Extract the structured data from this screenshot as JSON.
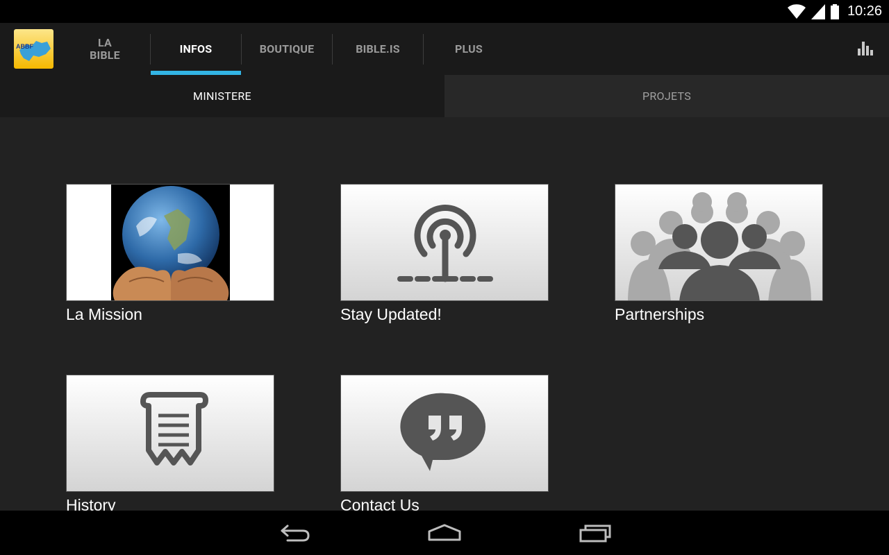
{
  "status_bar": {
    "time": "10:26",
    "icons": [
      "wifi-icon",
      "signal-icon",
      "battery-icon"
    ]
  },
  "action_bar": {
    "app_logo_text": "ABBF",
    "tabs": [
      {
        "label": "LA\nBIBLE",
        "active": false
      },
      {
        "label": "INFOS",
        "active": true
      },
      {
        "label": "BOUTIQUE",
        "active": false
      },
      {
        "label": "BIBLE.IS",
        "active": false
      },
      {
        "label": "PLUS",
        "active": false
      }
    ],
    "right_icon": "bar-chart-icon"
  },
  "subtabs": [
    {
      "label": "MINISTERE",
      "active": true
    },
    {
      "label": "PROJETS",
      "active": false
    }
  ],
  "cards": [
    {
      "label": "La Mission",
      "icon": "globe-in-hands-image"
    },
    {
      "label": "Stay Updated!",
      "icon": "broadcast-icon"
    },
    {
      "label": "Partnerships",
      "icon": "people-group-icon"
    },
    {
      "label": "History",
      "icon": "scroll-icon"
    },
    {
      "label": "Contact Us",
      "icon": "quote-bubble-icon"
    }
  ],
  "nav_bar": {
    "buttons": [
      "back-icon",
      "home-icon",
      "recents-icon"
    ]
  },
  "colors": {
    "accent": "#33b5e5",
    "background": "#222222",
    "action_bar": "#1a1a1a",
    "icon_gray": "#555555"
  }
}
